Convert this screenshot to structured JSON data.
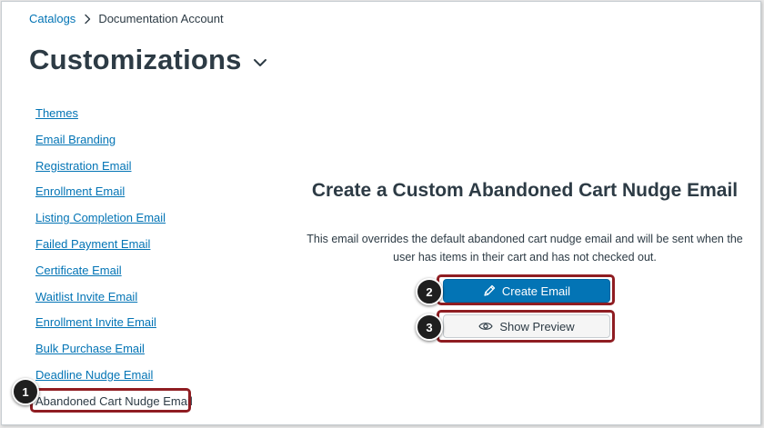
{
  "breadcrumb": {
    "parent": "Catalogs",
    "current": "Documentation Account"
  },
  "page": {
    "title": "Customizations"
  },
  "sidebar": {
    "items": [
      {
        "label": "Themes"
      },
      {
        "label": "Email Branding"
      },
      {
        "label": "Registration Email"
      },
      {
        "label": "Enrollment Email"
      },
      {
        "label": "Listing Completion Email"
      },
      {
        "label": "Failed Payment Email"
      },
      {
        "label": "Certificate Email"
      },
      {
        "label": "Waitlist Invite Email"
      },
      {
        "label": "Enrollment Invite Email"
      },
      {
        "label": "Bulk Purchase Email"
      },
      {
        "label": "Deadline Nudge Email"
      },
      {
        "label": "Abandoned Cart Nudge Email",
        "active": true
      }
    ]
  },
  "main": {
    "heading": "Create a Custom Abandoned Cart Nudge Email",
    "description": "This email overrides the default abandoned cart nudge email and will be sent when the user has items in their cart and has not checked out.",
    "create_button_label": "Create Email",
    "preview_button_label": "Show Preview"
  },
  "callouts": {
    "one": "1",
    "two": "2",
    "three": "3"
  },
  "icons": {
    "breadcrumb_separator": "chevron-right-icon",
    "title_toggle": "chevron-down-icon",
    "create": "pencil-icon",
    "preview": "eye-icon"
  },
  "colors": {
    "link": "#0374b5",
    "text": "#2d3b45",
    "primary_button": "#0374b5",
    "callout_border": "#8f1d22",
    "badge": "#1f1f1f"
  }
}
